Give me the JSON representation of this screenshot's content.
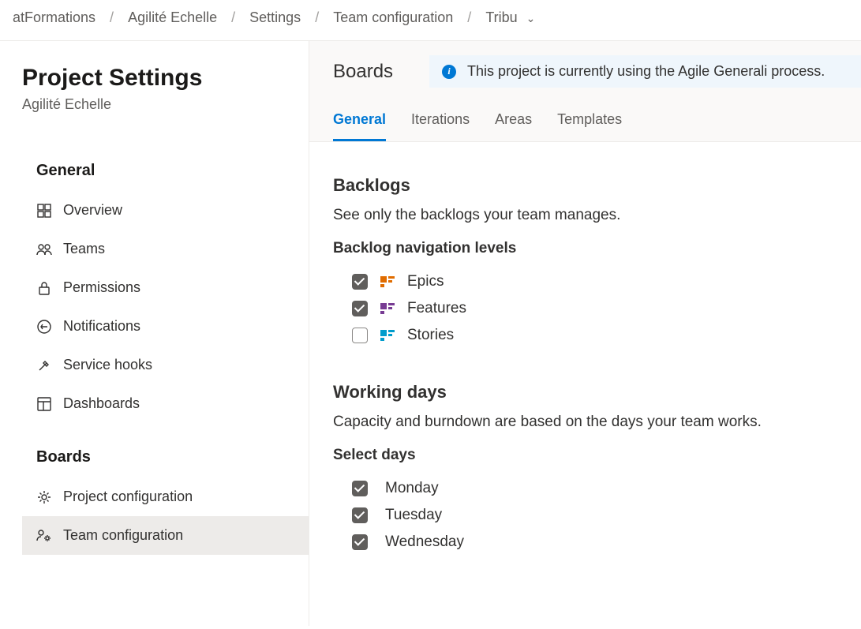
{
  "breadcrumb": {
    "items": [
      "atFormations",
      "Agilité Echelle",
      "Settings",
      "Team configuration",
      "Tribu"
    ]
  },
  "sidebar": {
    "title": "Project Settings",
    "subtitle": "Agilité Echelle",
    "groups": [
      {
        "title": "General",
        "items": [
          {
            "label": "Overview"
          },
          {
            "label": "Teams"
          },
          {
            "label": "Permissions"
          },
          {
            "label": "Notifications"
          },
          {
            "label": "Service hooks"
          },
          {
            "label": "Dashboards"
          }
        ]
      },
      {
        "title": "Boards",
        "items": [
          {
            "label": "Project configuration"
          },
          {
            "label": "Team configuration"
          }
        ]
      }
    ]
  },
  "header": {
    "title": "Boards",
    "info_text": "This project is currently using the Agile Generali process.",
    "tabs": [
      "General",
      "Iterations",
      "Areas",
      "Templates"
    ],
    "active_tab": "General"
  },
  "backlogs": {
    "heading": "Backlogs",
    "description": "See only the backlogs your team manages.",
    "subheading": "Backlog navigation levels",
    "levels": [
      {
        "label": "Epics",
        "checked": true,
        "kind": "epics"
      },
      {
        "label": "Features",
        "checked": true,
        "kind": "features"
      },
      {
        "label": "Stories",
        "checked": false,
        "kind": "stories"
      }
    ]
  },
  "working_days": {
    "heading": "Working days",
    "description": "Capacity and burndown are based on the days your team works.",
    "subheading": "Select days",
    "days": [
      {
        "label": "Monday",
        "checked": true
      },
      {
        "label": "Tuesday",
        "checked": true
      },
      {
        "label": "Wednesday",
        "checked": true
      }
    ]
  }
}
